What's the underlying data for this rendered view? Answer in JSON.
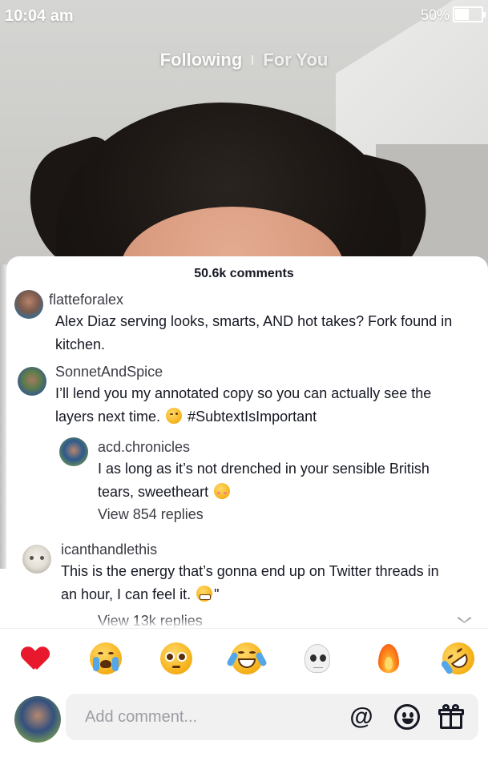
{
  "status_bar": {
    "time": "10:04 am",
    "battery_percent_label": "50%",
    "battery_level": 0.5
  },
  "feed_tabs": {
    "following": "Following",
    "for_you": "For You"
  },
  "comments_sheet": {
    "title": "50.6k comments",
    "comments": [
      {
        "username": "flatteforalex",
        "text": "Alex Diaz serving looks, smarts, AND hot takes? Fork found in kitchen."
      },
      {
        "username": "SonnetAndSpice",
        "text_before": "I’ll lend you my annotated copy so you can actually see the layers next time.",
        "emoji": "winking-face",
        "text_after": "#SubtextIsImportant",
        "reply": {
          "username": "acd.chronicles",
          "text": "I as long as it’s not drenched in your sensible British tears, sweetheart",
          "emoji": "kissing-face",
          "view_replies": "View 854 replies"
        }
      },
      {
        "username": "icanthandlethis",
        "text": "This is the energy that’s gonna end up on Twitter threads in an hour, I can feel it.",
        "emoji": "grimacing-face",
        "text_after": "\"",
        "view_replies": "View 13k replies"
      }
    ]
  },
  "emoji_bar": [
    "red-heart",
    "loudly-crying-face",
    "pleading-face",
    "face-with-tears-of-joy",
    "skull",
    "fire",
    "rolling-on-the-floor-laughing"
  ],
  "comment_input": {
    "placeholder": "Add comment...",
    "mention_icon": "at-sign-icon",
    "emoji_icon": "smiley-icon",
    "gift_icon": "gift-icon"
  },
  "colors": {
    "heart": "#e8192c",
    "text_primary": "#161823",
    "text_secondary": "#3b3b44",
    "placeholder": "#9c9da3",
    "input_bg": "#f1f1f2"
  }
}
